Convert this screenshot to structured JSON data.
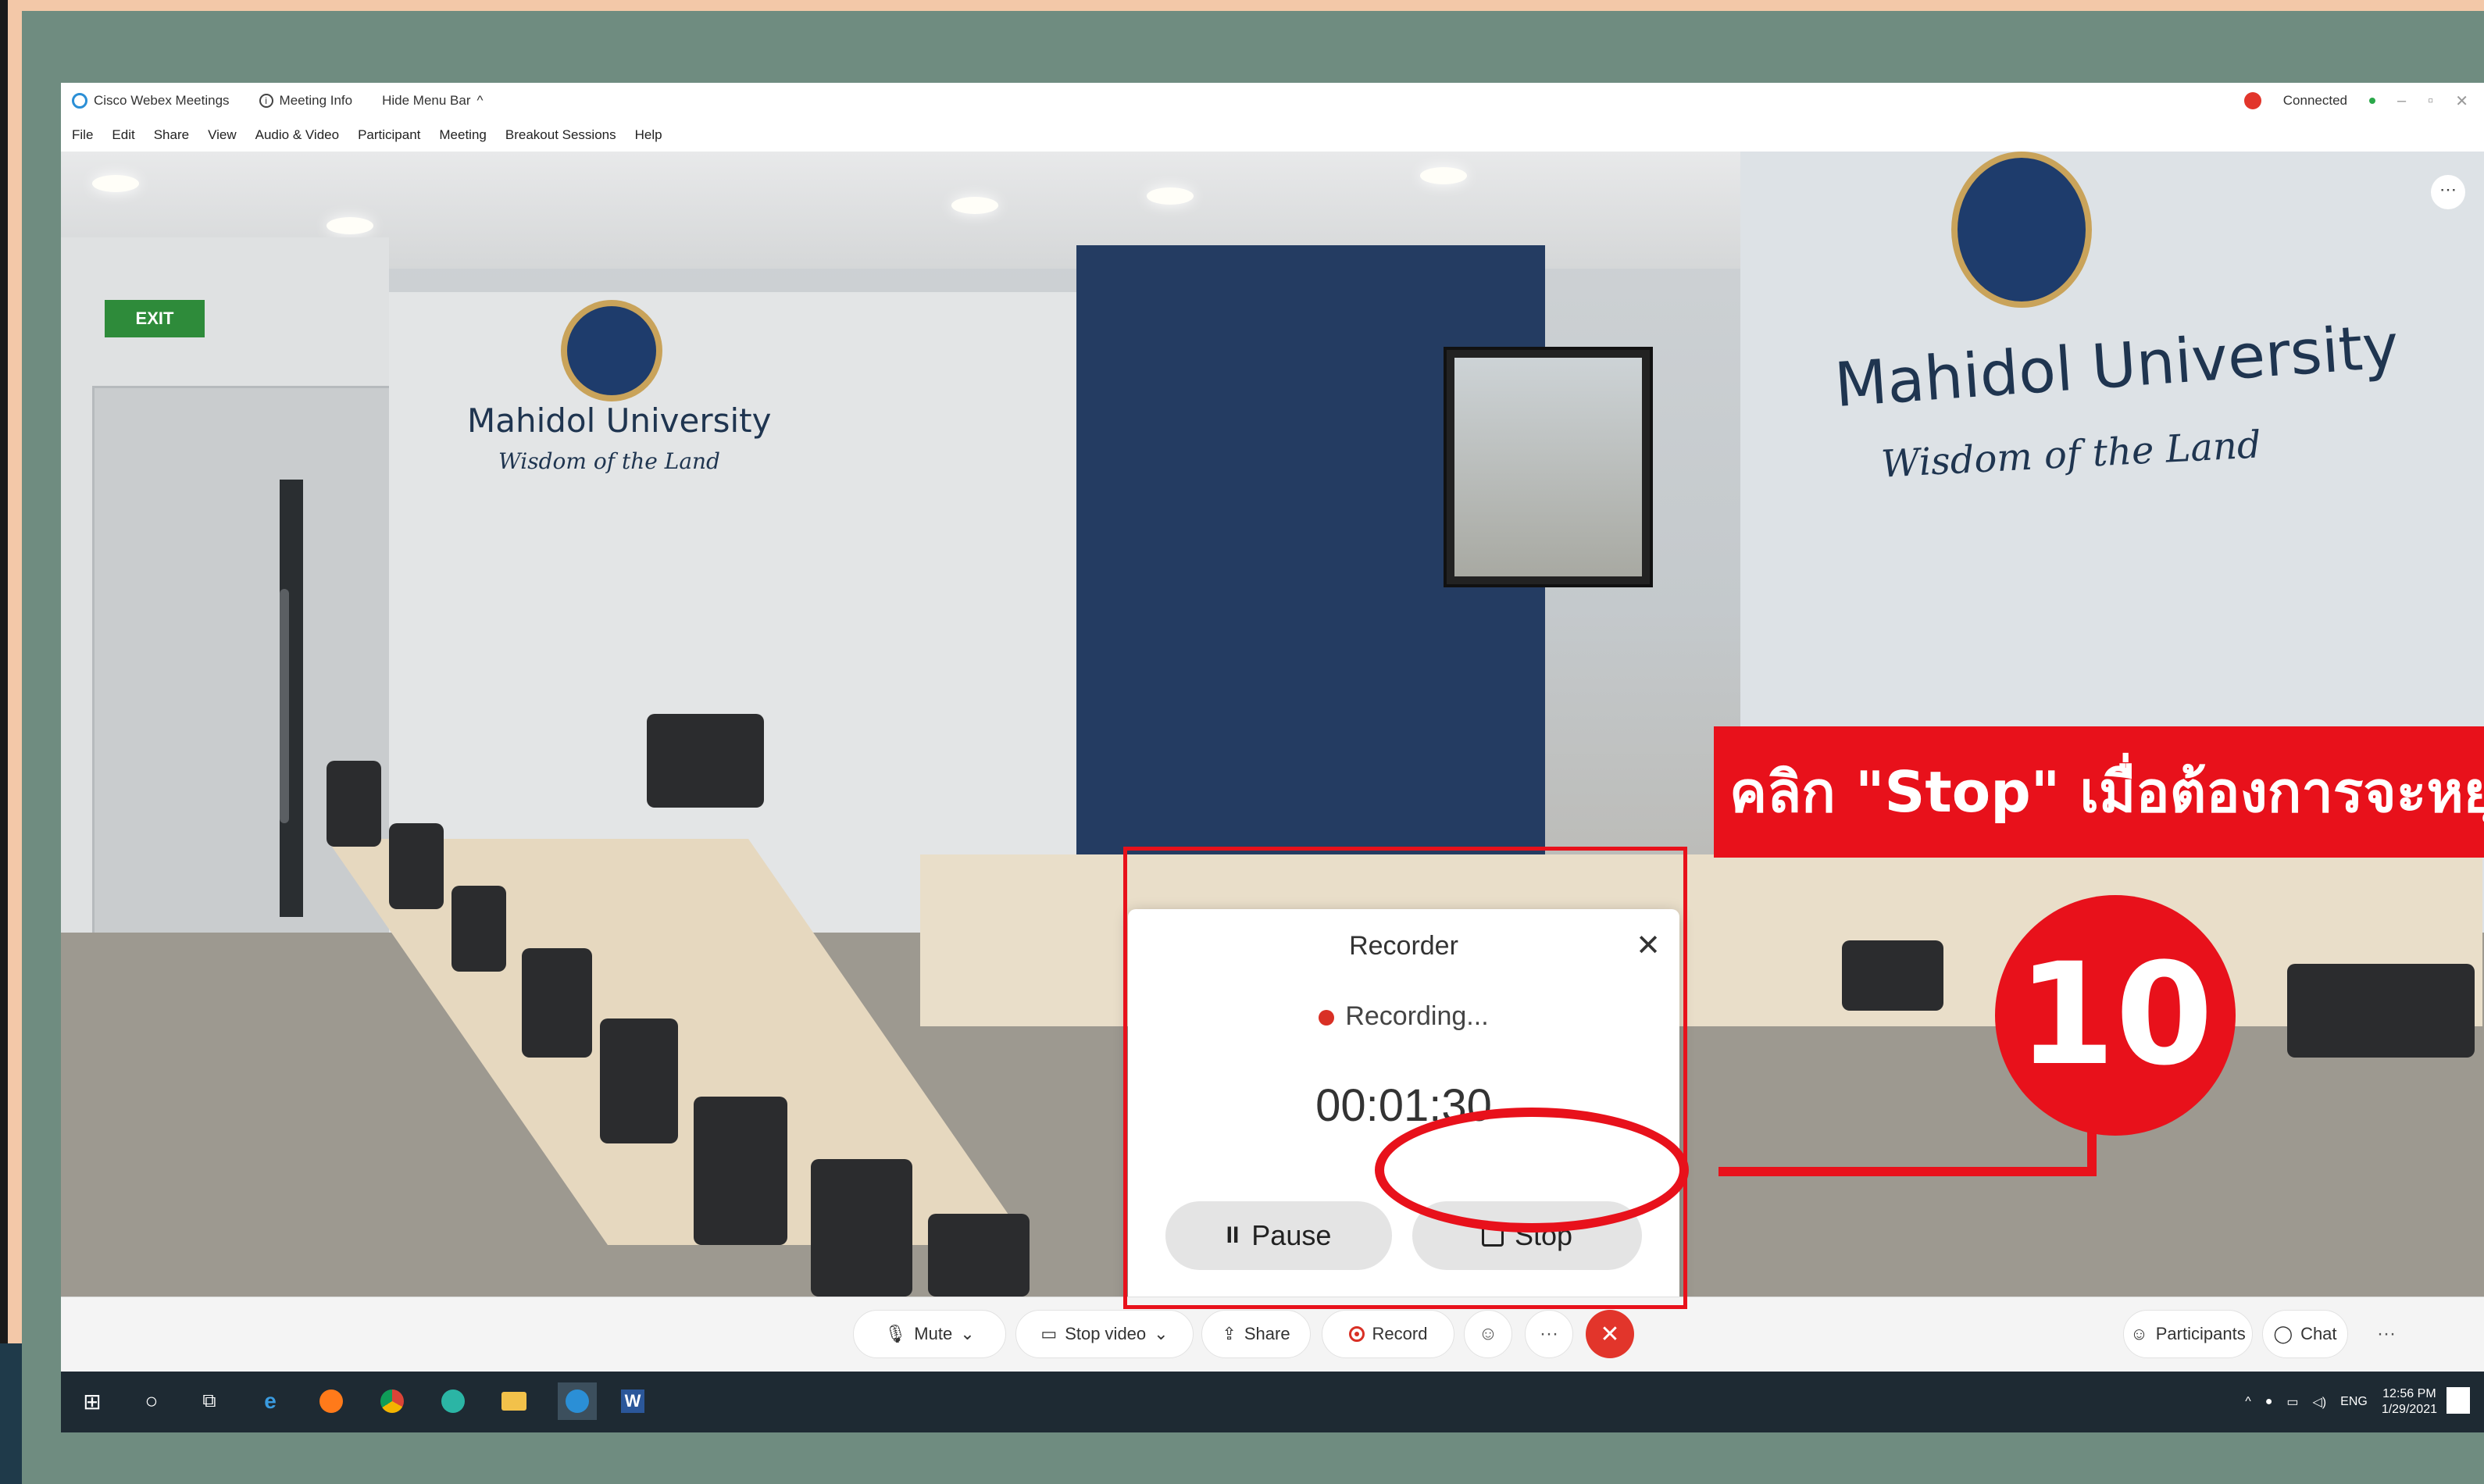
{
  "titlebar": {
    "app_name": "Cisco Webex Meetings",
    "meeting_info": "Meeting Info",
    "hide_menu": "Hide Menu Bar",
    "hide_menu_caret": "^",
    "connection_status": "Connected",
    "minimize": "–",
    "restore": "▫",
    "close": "✕"
  },
  "menubar": {
    "items": [
      "File",
      "Edit",
      "Share",
      "View",
      "Audio & Video",
      "Participant",
      "Meeting",
      "Breakout Sessions",
      "Help"
    ]
  },
  "video": {
    "more_glyph": "⋯",
    "exit_sign": "EXIT",
    "university_name": "Mahidol University",
    "university_motto": "Wisdom of the Land"
  },
  "recorder": {
    "title": "Recorder",
    "close": "✕",
    "status": "Recording...",
    "timer": "00:01:30",
    "pause_label": "Pause",
    "pause_glyph": "II",
    "stop_label": "Stop"
  },
  "controls": {
    "mute": "Mute",
    "mute_glyph": "🎙",
    "stop_video": "Stop video",
    "video_glyph": "▭",
    "share": "Share",
    "share_glyph": "⇪",
    "record": "Record",
    "reactions_glyph": "☺",
    "more_glyph": "···",
    "end_glyph": "✕",
    "dropdown_glyph": "⌄",
    "participants": "Participants",
    "participants_glyph": "☺",
    "chat": "Chat",
    "chat_glyph": "◯",
    "panel_more": "···"
  },
  "taskbar": {
    "start_glyph": "⊞",
    "search_glyph": "○",
    "taskview_glyph": "⧉",
    "edge_glyph": "e",
    "word_glyph": "W",
    "tray_up": "^",
    "language": "ENG",
    "time": "12:56 PM",
    "date": "1/29/2021"
  },
  "annotation": {
    "instruction": "คลิก \"Stop\" เมื่อต้องการจะหยุด",
    "step_number": "10"
  },
  "colors": {
    "frame_bg": "#6f8c80",
    "accent_red": "#e8111b",
    "end_call_red": "#e2352b",
    "taskbar": "#1e2a33"
  }
}
